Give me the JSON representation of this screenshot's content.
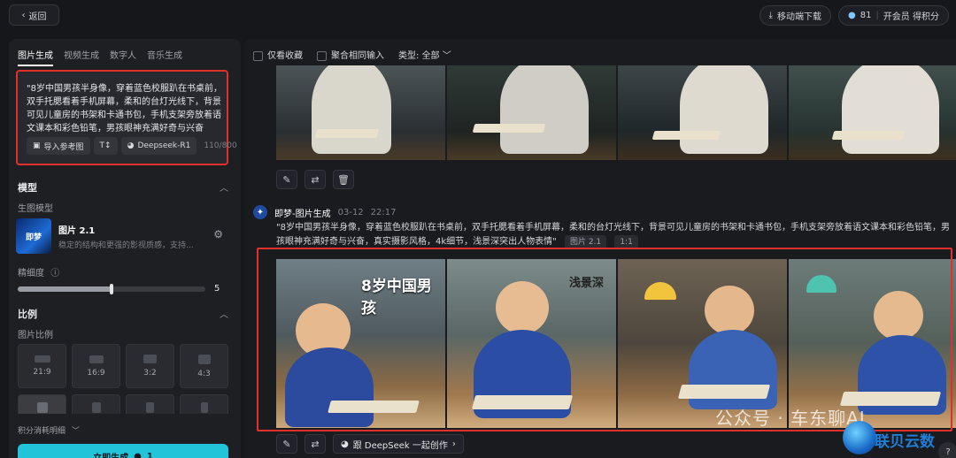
{
  "topbar": {
    "back_label": "返回",
    "download_label": "移动端下载",
    "credits_value": "81",
    "member_label": "开会员 得积分"
  },
  "left": {
    "tabs": [
      "图片生成",
      "视频生成",
      "数字人",
      "音乐生成"
    ],
    "prompt_text": "\"8岁中国男孩半身像，穿着蓝色校服趴在书桌前，双手托腮看着手机屏幕，柔和的台灯光线下，背景可见儿童房的书架和卡通书包，手机支架旁放着语文课本和彩色铅笔，男孩眼神充满好奇与兴奋",
    "import_ref_label": "导入参考图",
    "deepseek_label": "Deepseek-R1",
    "char_count": "110/800",
    "model_section": "模型",
    "gen_model_label": "生图模型",
    "model_name": "图片 2.1",
    "model_desc": "稳定的结构和更强的影视质感，支持...",
    "model_thumb_text": "即梦",
    "detail_label": "精细度",
    "detail_value": "5",
    "detail_fraction": 0.5,
    "ratio_section": "比例",
    "ratio_label": "图片比例",
    "ratios": [
      "21:9",
      "16:9",
      "3:2",
      "4:3"
    ],
    "credits_detail_label": "积分消耗明细",
    "generate_label": "立即生成",
    "generate_cost": "1"
  },
  "main": {
    "filter_collect": "仅看收藏",
    "filter_merge": "聚合相同输入",
    "filter_type": "类型: 全部",
    "gen_name": "即梦-图片生成",
    "gen_date": "03-12",
    "gen_time": "22:17",
    "gen_prompt": "\"8岁中国男孩半身像，穿着蓝色校服趴在书桌前，双手托腮看着手机屏幕，柔和的台灯光线下，背景可见儿童房的书架和卡通书包，手机支架旁放着语文课本和彩色铅笔，男孩眼神充满好奇与兴奋，真实摄影风格，4k细节，浅景深突出人物表情\"",
    "tag_model": "图片 2.1",
    "tag_ratio": "1:1",
    "deepseek_create_label": "跟 DeepSeek 一起创作",
    "img1_overlay": "8岁中国男孩",
    "img2_overlay": "浅景深",
    "watermark_text": "公众号 · 车东聊AI",
    "watermark_brand": "联贝云数",
    "help_label": "?"
  }
}
